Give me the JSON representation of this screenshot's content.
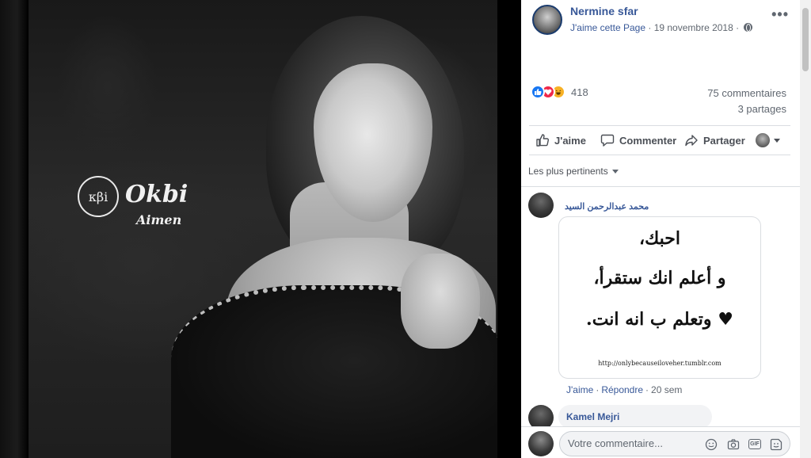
{
  "watermark": {
    "logo": "κβi",
    "name": "Okbi",
    "sub": "Aimen"
  },
  "post": {
    "page_name": "Nermine sfar",
    "like_page": "J'aime cette Page",
    "separator": "·",
    "date": "19 novembre 2018",
    "more": "•••"
  },
  "stats": {
    "reactions_count": "418",
    "comments": "75 commentaires",
    "shares": "3 partages"
  },
  "actions": {
    "like": "J'aime",
    "comment": "Commenter",
    "share": "Partager"
  },
  "sort_label": "Les plus pertinents",
  "comments": [
    {
      "author": "محمد عبدالرحمن السيد",
      "image_lines": [
        "احبك،",
        "و أعلم انك ستقرأ،",
        "وتعلم ب انه انت."
      ],
      "image_heart": "♥",
      "image_url": "http://onlybecauseiloveher.tumblr.com",
      "like": "J'aime",
      "reply": "Répondre",
      "time": "20 sem"
    },
    {
      "author": "Kamel Mejri"
    }
  ],
  "composer": {
    "placeholder": "Votre commentaire...",
    "gif": "GIF"
  },
  "colors": {
    "link": "#385898",
    "like_blue": "#1877f2",
    "love_red": "#f0284a",
    "haha_yellow": "#f7b125"
  }
}
